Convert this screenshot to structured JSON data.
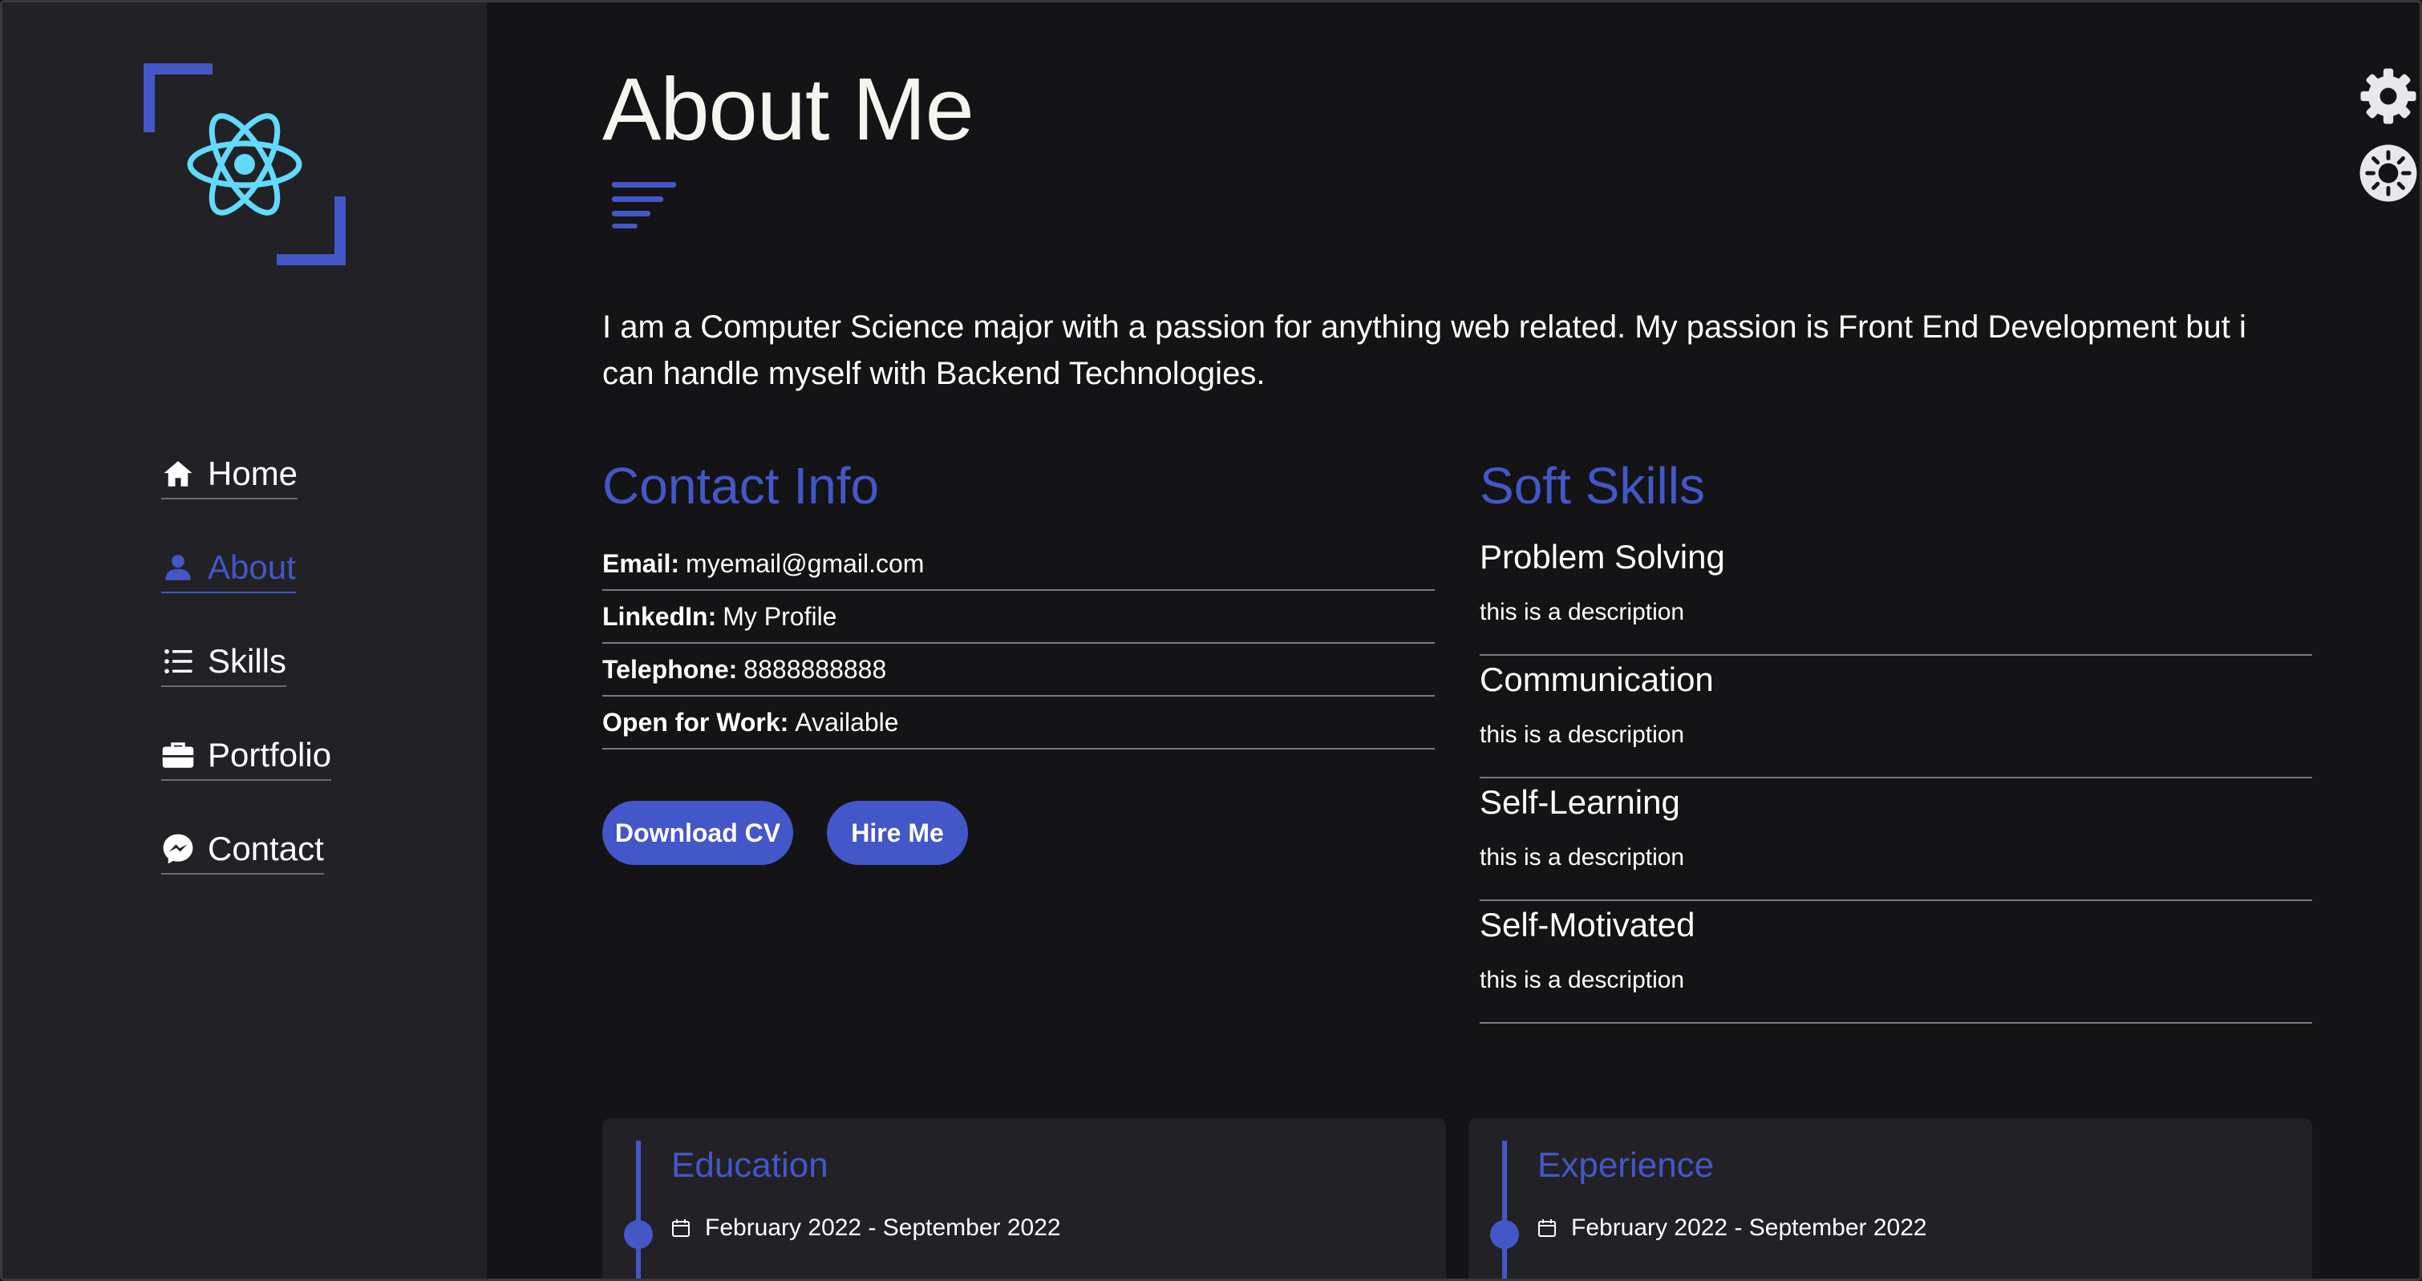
{
  "sidebar": {
    "nav": [
      {
        "label": "Home",
        "icon": "home-icon"
      },
      {
        "label": "About",
        "icon": "user-icon",
        "active": true
      },
      {
        "label": "Skills",
        "icon": "list-icon"
      },
      {
        "label": "Portfolio",
        "icon": "briefcase-icon"
      },
      {
        "label": "Contact",
        "icon": "messenger-icon"
      }
    ]
  },
  "header": {
    "title": "About Me"
  },
  "intro": "I am a Computer Science major with a passion for anything web related. My passion is Front End Development but i can handle myself with Backend Technologies.",
  "contact": {
    "title": "Contact Info",
    "rows": [
      {
        "label": "Email:",
        "value": "myemail@gmail.com"
      },
      {
        "label": "LinkedIn:",
        "value": "My Profile"
      },
      {
        "label": "Telephone:",
        "value": "8888888888"
      },
      {
        "label": "Open for Work:",
        "value": "Available"
      }
    ],
    "download_label": "Download CV",
    "hire_label": "Hire Me"
  },
  "soft_skills": {
    "title": "Soft Skills",
    "items": [
      {
        "name": "Problem Solving",
        "desc": "this is a description"
      },
      {
        "name": "Communication",
        "desc": "this is a description"
      },
      {
        "name": "Self-Learning",
        "desc": "this is a description"
      },
      {
        "name": "Self-Motivated",
        "desc": "this is a description"
      }
    ]
  },
  "education": {
    "title": "Education",
    "date": "February 2022 - September 2022"
  },
  "experience": {
    "title": "Experience",
    "date": "February 2022 - September 2022"
  },
  "colors": {
    "accent": "#4357c9",
    "sidebar_bg": "#222125",
    "page_bg": "#141416",
    "react_logo": "#61dafb"
  }
}
